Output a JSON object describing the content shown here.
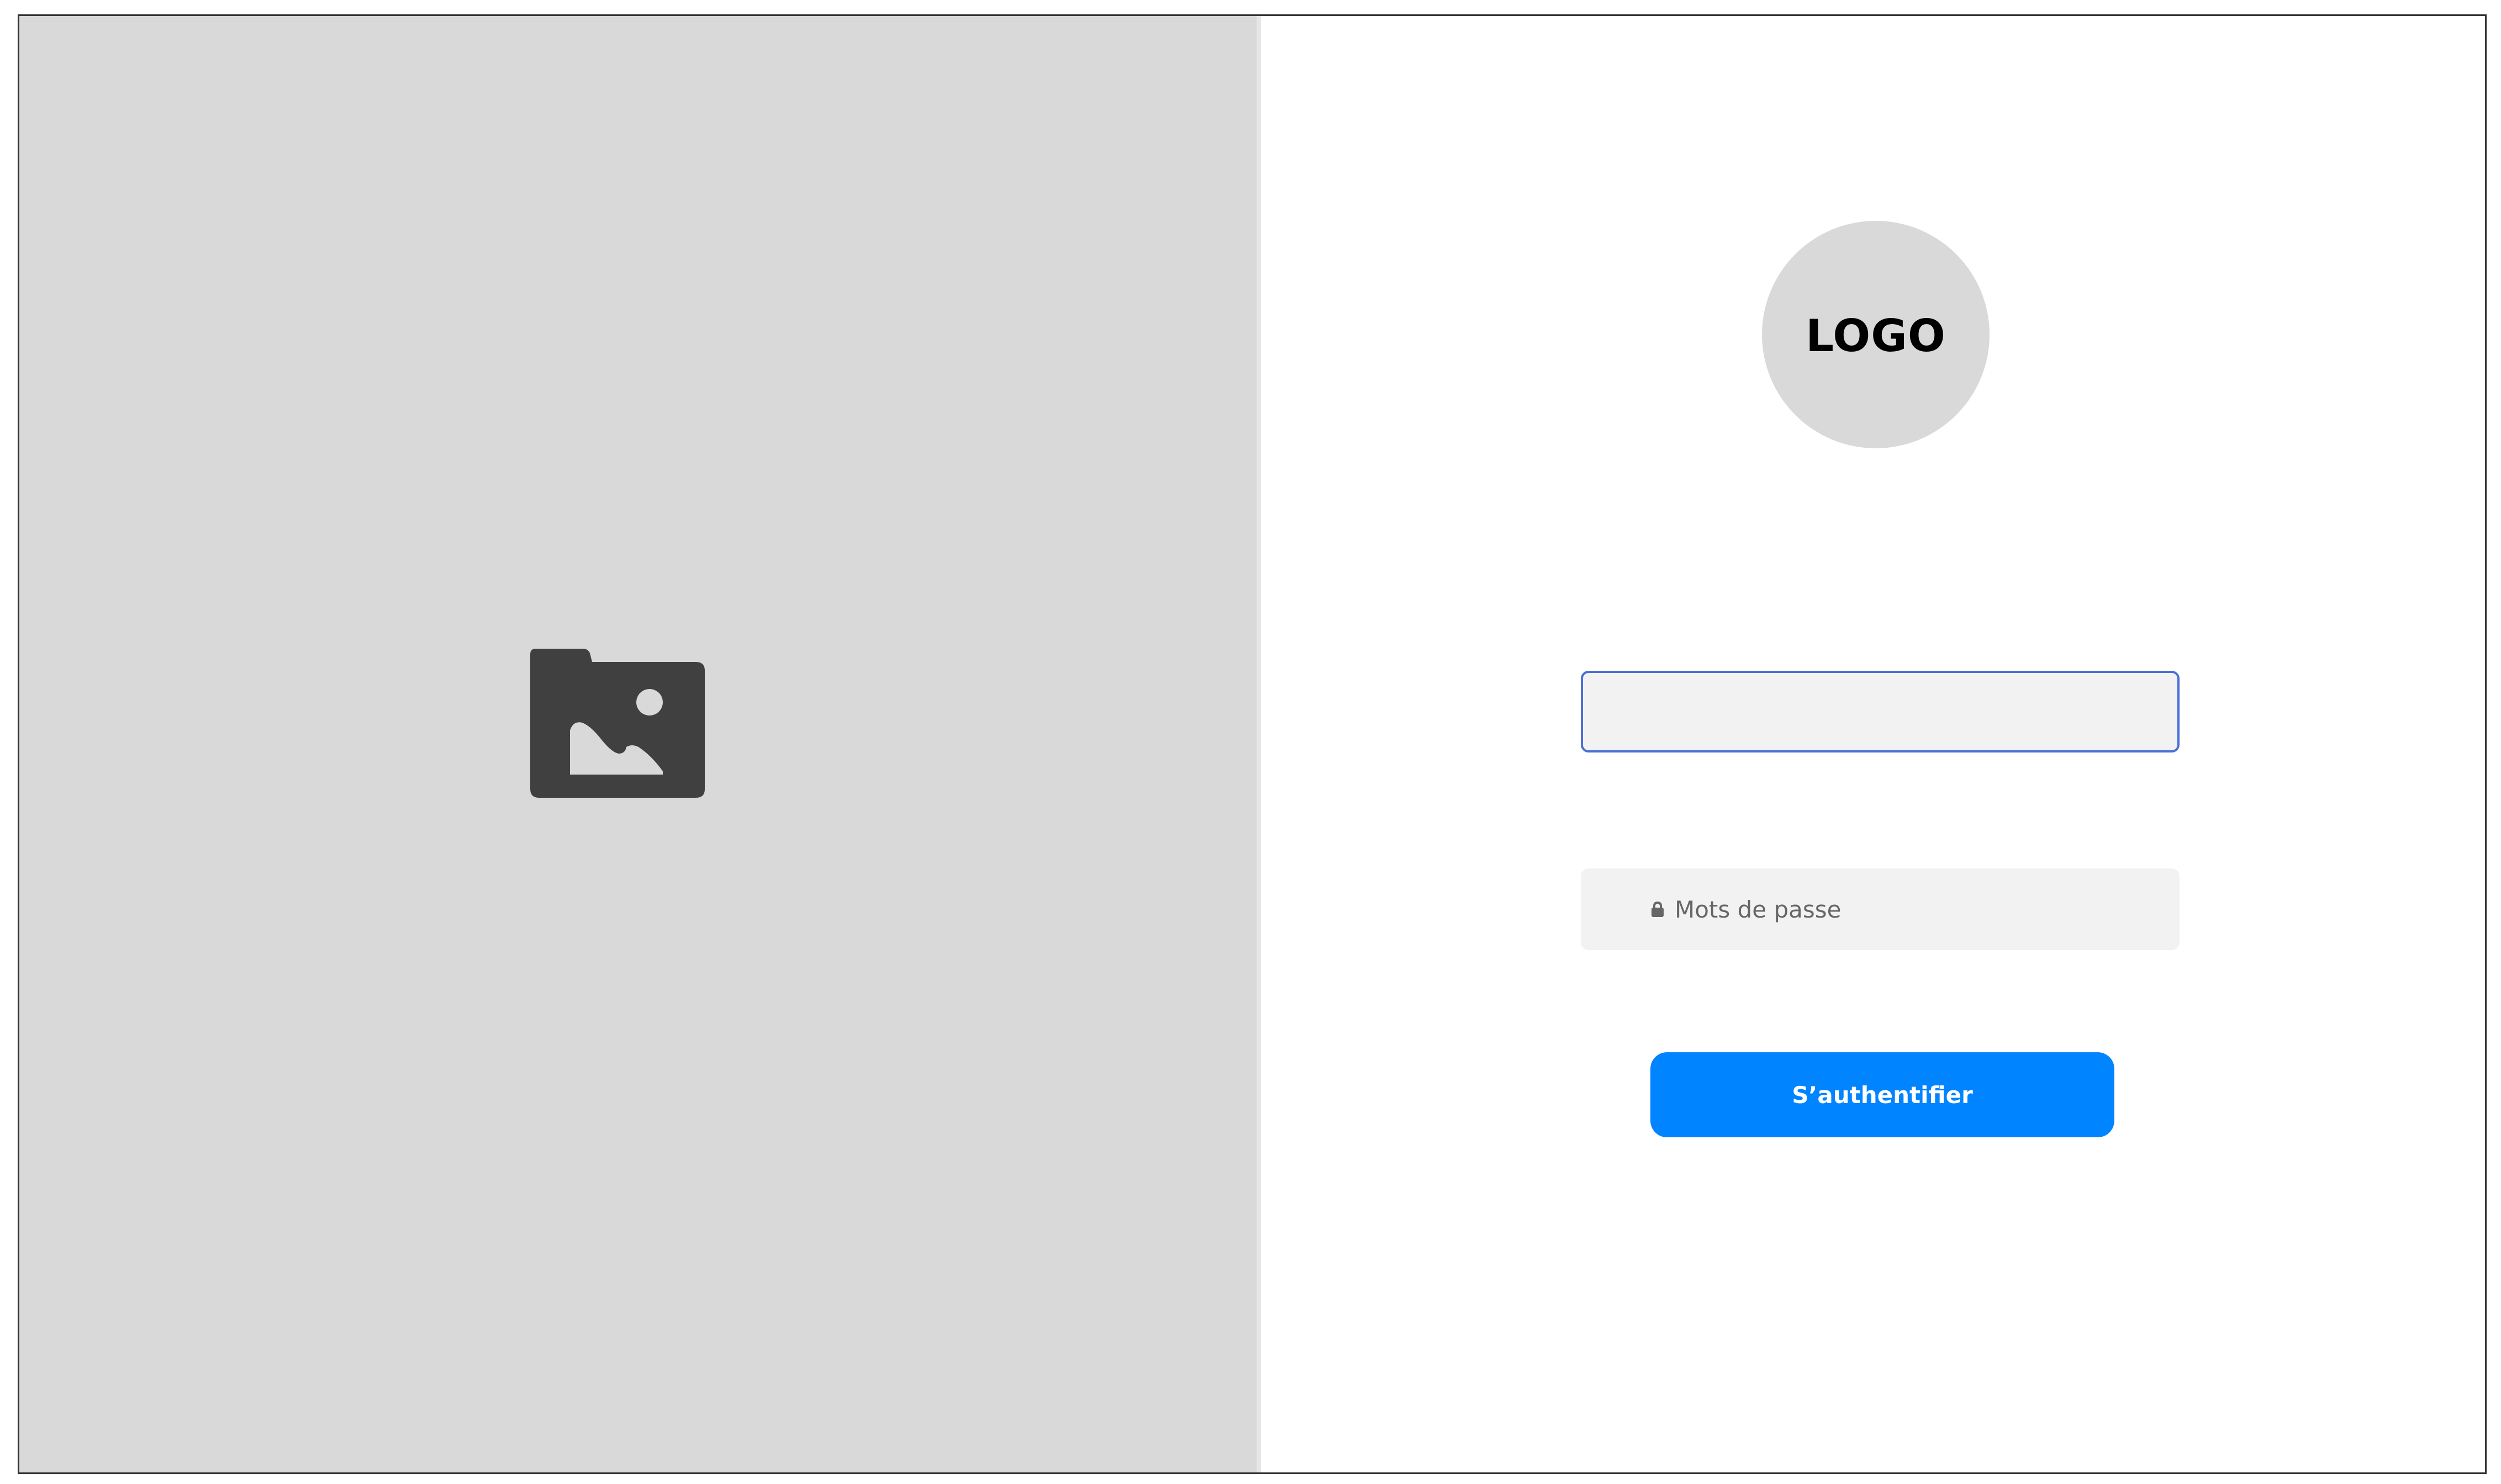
{
  "brand": {
    "logo_text": "LOGO"
  },
  "hero": {
    "image_icon": "image-folder-icon"
  },
  "login_form": {
    "username": {
      "value": "",
      "placeholder": ""
    },
    "password": {
      "value": "",
      "placeholder": "Mots de passe",
      "icon": "lock-icon"
    },
    "submit_label": "S’authentifier"
  },
  "colors": {
    "left_panel_bg": "#d9d9d9",
    "logo_bg": "#d9d9d9",
    "field_bg": "#f2f2f2",
    "focus_border": "#4a6fd6",
    "button_bg": "#0084ff",
    "button_text": "#ffffff",
    "icon_fill": "#404040"
  }
}
